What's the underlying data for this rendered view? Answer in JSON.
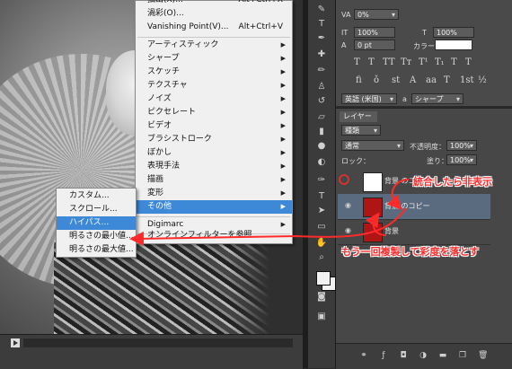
{
  "menu": {
    "top_items": [
      {
        "label": "抽出(X)...",
        "shortcut": "Alt+Ctrl+X"
      },
      {
        "label": "渦彩(O)..."
      },
      {
        "label": "Vanishing Point(V)...",
        "shortcut": "Alt+Ctrl+V"
      }
    ],
    "filter_items": [
      {
        "label": "アーティスティック"
      },
      {
        "label": "シャープ"
      },
      {
        "label": "スケッチ"
      },
      {
        "label": "テクスチャ"
      },
      {
        "label": "ノイズ"
      },
      {
        "label": "ピクセレート"
      },
      {
        "label": "ビデオ"
      },
      {
        "label": "ブラシストローク"
      },
      {
        "label": "ぼかし"
      },
      {
        "label": "表現手法"
      },
      {
        "label": "描画"
      },
      {
        "label": "変形"
      },
      {
        "label": "その他"
      }
    ],
    "plugin_items": [
      {
        "label": "Digimarc"
      }
    ],
    "online_item": "オンラインフィルターを参照..."
  },
  "submenu": {
    "items": [
      "カスタム...",
      "スクロール...",
      "ハイパス...",
      "明るさの最小値...",
      "明るさの最大値..."
    ],
    "highlighted_index": 2
  },
  "character_panel": {
    "leading": "0%",
    "scale_v": "100%",
    "scale_h": "100%",
    "baseline": "0 pt",
    "color_label": "カラー：",
    "color_value": "#ffffff",
    "aa_language": "英語 (米国)",
    "aa_method": "シャープ",
    "aa_prefix": "a"
  },
  "layers": {
    "tab_label": "レイヤー",
    "kind_filter": "種類",
    "blend_mode": "通常",
    "opacity_label": "不透明度：",
    "opacity_value": "100%",
    "lock_label": "ロック：",
    "fill_label": "塗り：",
    "fill_value": "100%",
    "rows": [
      {
        "name": "背景 のコピー 2",
        "thumb": "white"
      },
      {
        "name": "背景 のコピー",
        "thumb": "red"
      },
      {
        "name": "背景",
        "thumb": "red"
      }
    ]
  },
  "annotations": {
    "note1": "統合したら非表示",
    "note2": "もう一回複製して彩度を落とす"
  },
  "colors": {
    "highlight": "#3e88d8",
    "annotation": "#ff2a2a"
  }
}
